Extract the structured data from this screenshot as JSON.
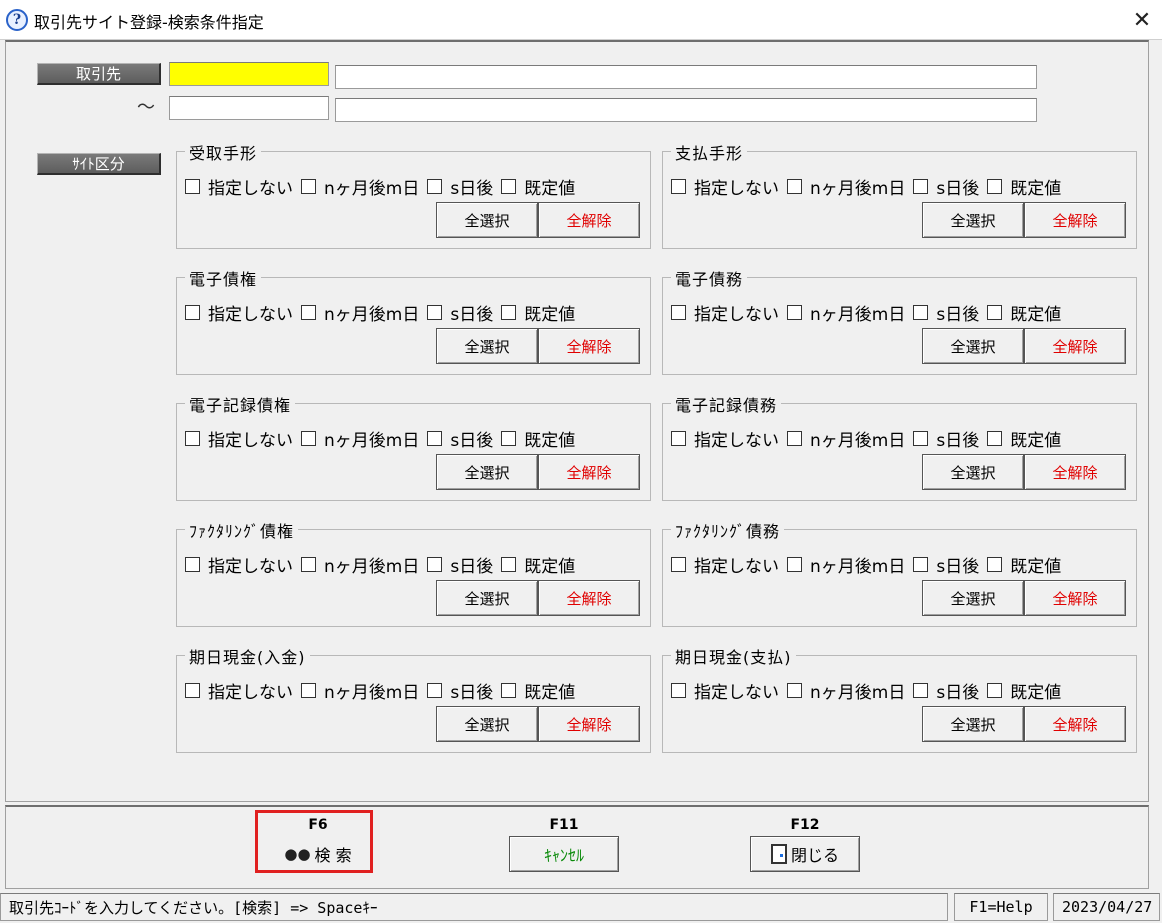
{
  "window": {
    "title": "取引先サイト登録-検索条件指定",
    "close": "✕",
    "help_glyph": "?"
  },
  "form": {
    "torihikisaki_label": "取引先",
    "tilde": "～",
    "site_kubun_label": "ｻｲﾄ区分"
  },
  "option_labels": [
    "指定しない",
    "nヶ月後m日",
    "s日後",
    "既定値"
  ],
  "buttons": {
    "select_all": "全選択",
    "clear_all": "全解除"
  },
  "groups": [
    {
      "title": "受取手形"
    },
    {
      "title": "支払手形"
    },
    {
      "title": "電子債権"
    },
    {
      "title": "電子債務"
    },
    {
      "title": "電子記録債権"
    },
    {
      "title": "電子記録債務"
    },
    {
      "title": "ﾌｧｸﾀﾘﾝｸﾞ債権"
    },
    {
      "title": "ﾌｧｸﾀﾘﾝｸﾞ債務"
    },
    {
      "title": "期日現金(入金)"
    },
    {
      "title": "期日現金(支払)"
    }
  ],
  "fkeys": {
    "f6": {
      "key": "F6",
      "label": "検 索",
      "icon": "binoculars-icon"
    },
    "f11": {
      "key": "F11",
      "label": "ｷｬﾝｾﾙ"
    },
    "f12": {
      "key": "F12",
      "label": "閉じる",
      "icon": "door-icon"
    }
  },
  "status": {
    "message": "取引先ｺｰﾄﾞを入力してください。[検索] => Spaceｷｰ",
    "help": "F1=Help",
    "date": "2023/04/27"
  },
  "colors": {
    "required_field": "#ffff00",
    "clear_text": "#e00000",
    "cancel_text": "#0a8a0a",
    "highlight": "#e02020"
  }
}
